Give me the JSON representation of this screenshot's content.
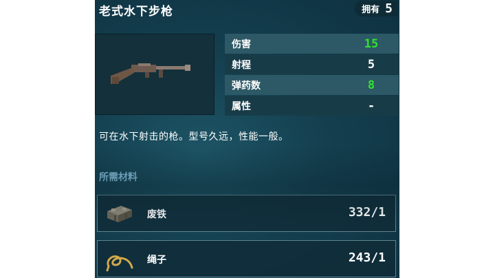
{
  "item": {
    "title": "老式水下步枪",
    "owned_label": "拥有",
    "owned_count": "5",
    "weapon_icon": "rifle-icon"
  },
  "stats": [
    {
      "name": "伤害",
      "value": "15",
      "color": "#31e22e"
    },
    {
      "name": "射程",
      "value": "5",
      "color": "#ffffff"
    },
    {
      "name": "弹药数",
      "value": "8",
      "color": "#31e22e"
    },
    {
      "name": "属性",
      "value": "-",
      "color": "#ffffff"
    }
  ],
  "description": "可在水下射击的枪。型号久远，性能一般。",
  "materials_title": "所需材料",
  "materials": [
    {
      "name": "废铁",
      "count": "332/1",
      "icon": "scrap-metal-icon"
    },
    {
      "name": "绳子",
      "count": "243/1",
      "icon": "rope-icon"
    }
  ]
}
